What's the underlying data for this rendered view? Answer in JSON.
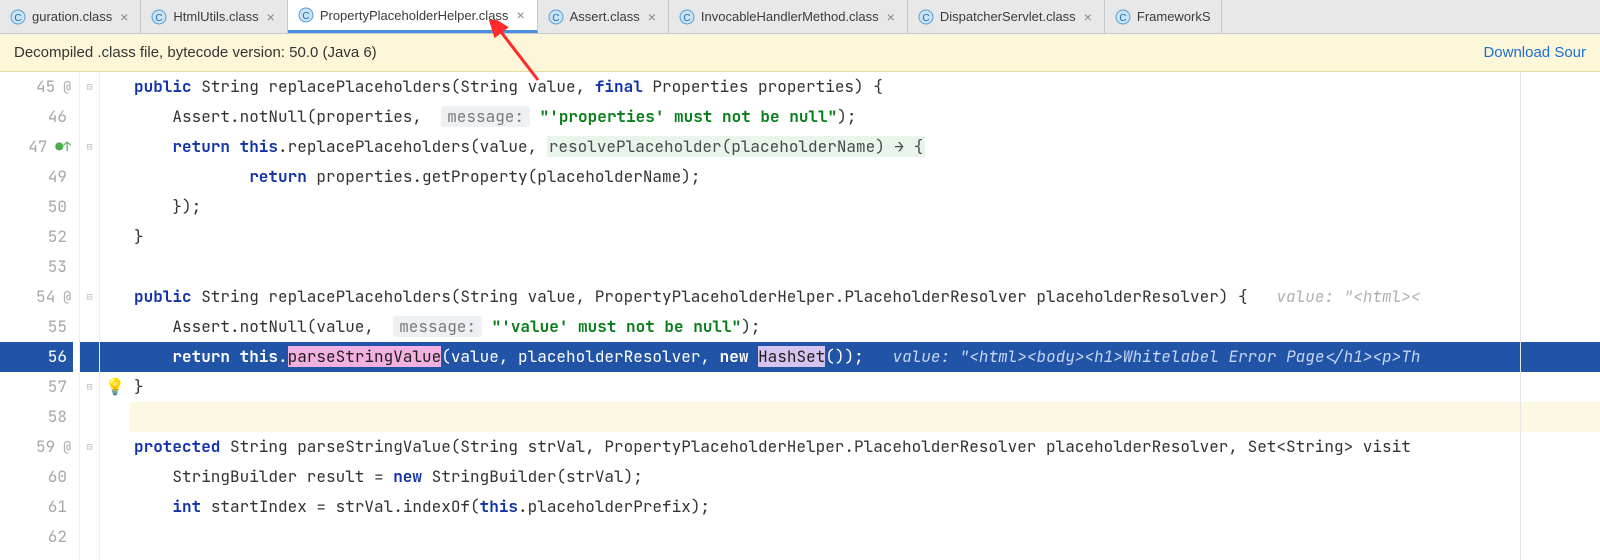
{
  "tabs": [
    {
      "label": "guration.class"
    },
    {
      "label": "HtmlUtils.class"
    },
    {
      "label": "PropertyPlaceholderHelper.class",
      "active": true
    },
    {
      "label": "Assert.class"
    },
    {
      "label": "InvocableHandlerMethod.class"
    },
    {
      "label": "DispatcherServlet.class"
    },
    {
      "label": "FrameworkS"
    }
  ],
  "infobar": {
    "text": "Decompiled .class file, bytecode version: 50.0 (Java 6)",
    "link": "Download Sour"
  },
  "gutter": [
    "45",
    "46",
    "47",
    "49",
    "50",
    "52",
    "53",
    "54",
    "55",
    "56",
    "57",
    "58",
    "59",
    "60",
    "61",
    "62"
  ],
  "gutter_marks": {
    "0": "@",
    "2": "●↑",
    "7": "@",
    "12": "@"
  },
  "code": {
    "l45": {
      "kw1": "public",
      "t1": " String replacePlaceholders(String value, ",
      "kw2": "final",
      "t2": " Properties properties) {"
    },
    "l46": {
      "t1": "    Assert.notNull(properties,  ",
      "hint": "message:",
      "str": " \"'properties' must not be null\"",
      "t2": ");"
    },
    "l47": {
      "kw1": "return this",
      "t1": ".replacePlaceholders(value, ",
      "lambda": "resolvePlaceholder(placeholderName) → {"
    },
    "l49": {
      "kw1": "return",
      "t1": " properties.getProperty(placeholderName);"
    },
    "l50": {
      "t": "    });"
    },
    "l52": {
      "t": "}"
    },
    "l54": {
      "kw1": "public",
      "t1": " String replacePlaceholders(String value, PropertyPlaceholderHelper.PlaceholderResolver placeholderResolver) {",
      "hint": "   value: \"<html><"
    },
    "l55": {
      "t1": "    Assert.notNull(value,  ",
      "hint": "message:",
      "str": " \"'value' must not be null\"",
      "t2": ");"
    },
    "l56": {
      "kw1": "return this",
      "t1": ".",
      "pink": "parseStringValue",
      "t2": "(value, placeholderResolver, ",
      "kw2": "new",
      "t3": " ",
      "lav": "HashSet",
      "t4": "());",
      "hint2": "   value: \"<html><body><h1>Whitelabel Error Page</h1><p>Th"
    },
    "l57": {
      "t": "}"
    },
    "l59": {
      "kw1": "protected",
      "t1": " String parseStringValue(String strVal, PropertyPlaceholderHelper.PlaceholderResolver placeholderResolver, Set<String> visit"
    },
    "l60": {
      "t1": "    StringBuilder result = ",
      "kw1": "new",
      "t2": " StringBuilder(strVal);"
    },
    "l61": {
      "kw1": "int",
      "t1": " startIndex = strVal.indexOf(",
      "kw2": "this",
      "t2": ".placeholderPrefix);"
    }
  },
  "icons": {
    "class": "C",
    "close": "×",
    "bulb": "💡"
  }
}
